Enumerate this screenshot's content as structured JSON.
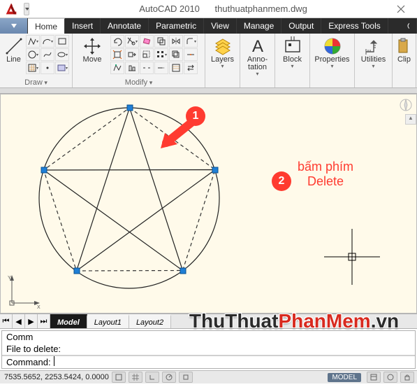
{
  "app": {
    "product": "AutoCAD 2010",
    "filename": "thuthuatphanmem.dwg"
  },
  "tabs": {
    "home": "Home",
    "insert": "Insert",
    "annotate": "Annotate",
    "parametric": "Parametric",
    "view": "View",
    "manage": "Manage",
    "output": "Output",
    "express": "Express Tools"
  },
  "ribbon": {
    "draw": {
      "title": "Draw",
      "line_label": "Line"
    },
    "modify": {
      "title": "Modify",
      "move_label": "Move"
    },
    "layers": {
      "label": "Layers"
    },
    "annotation": {
      "label_1": "Anno-",
      "label_2": "tation"
    },
    "block": {
      "label": "Block"
    },
    "properties": {
      "label": "Properties"
    },
    "utilities": {
      "label": "Utilities"
    },
    "clip": {
      "label": "Clip"
    }
  },
  "callouts": {
    "one": "1",
    "two": "2",
    "text_1": "bấm phím",
    "text_2": "Delete"
  },
  "doc_tabs": {
    "model": "Model",
    "layout1": "Layout1",
    "layout2": "Layout2"
  },
  "command": {
    "line1_prefix": "Comm",
    "line2": "File to delete:",
    "prompt": "Command:"
  },
  "status": {
    "coords": "7535.5652, 2253.5424, 0.0000",
    "model_btn": "MODEL"
  },
  "watermark": {
    "p1": "ThuThuat",
    "p2": "PhanMem",
    "p3": ".vn"
  }
}
